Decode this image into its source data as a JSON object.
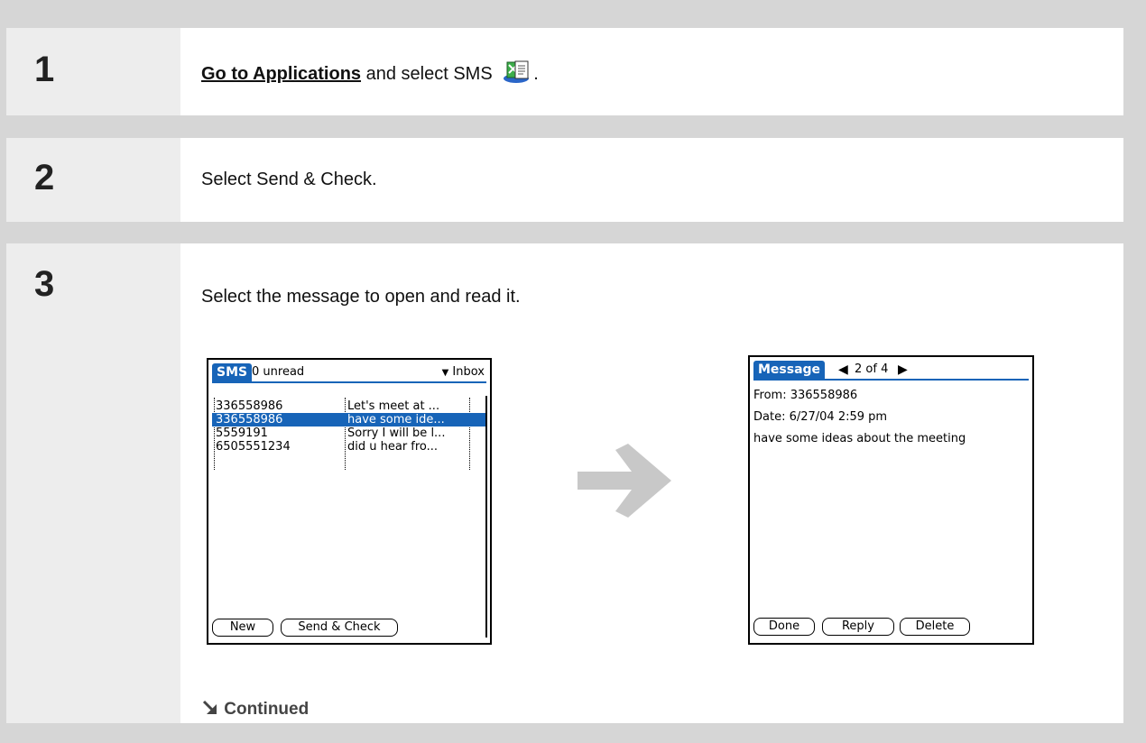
{
  "steps": [
    {
      "number": "1",
      "link_text": "Go to Applications",
      "text_after": " and select SMS ",
      "text_end": "."
    },
    {
      "number": "2",
      "text": "Select Send & Check."
    },
    {
      "number": "3",
      "text": "Select the message to open and read it.",
      "continued": "Continued"
    }
  ],
  "sms_list": {
    "tab": "SMS",
    "unread": "0 unread",
    "folder": "Inbox",
    "rows": [
      {
        "sender": "336558986",
        "preview": "Let's meet at ..."
      },
      {
        "sender": "336558986",
        "preview": "have some ide..."
      },
      {
        "sender": "5559191",
        "preview": "Sorry I will be l..."
      },
      {
        "sender": "6505551234",
        "preview": "did u hear fro..."
      }
    ],
    "buttons": {
      "new": "New",
      "send_check": "Send & Check"
    }
  },
  "message_view": {
    "tab": "Message",
    "position": "2 of 4",
    "from": "From: 336558986",
    "date": "Date: 6/27/04 2:59 pm",
    "body": "have some ideas about the meeting",
    "buttons": {
      "done": "Done",
      "reply": "Reply",
      "delete": "Delete"
    }
  },
  "icons": {
    "sms_app": "sms-app-icon",
    "arrow": "right-arrow-icon",
    "continued": "continued-arrow-icon",
    "prev": "prev-triangle-icon",
    "next": "next-triangle-icon",
    "dropdown": "dropdown-triangle-icon"
  },
  "colors": {
    "palm_blue": "#1764b8",
    "step_gray": "#ededed",
    "arrow_gray": "#c8c8c8"
  }
}
